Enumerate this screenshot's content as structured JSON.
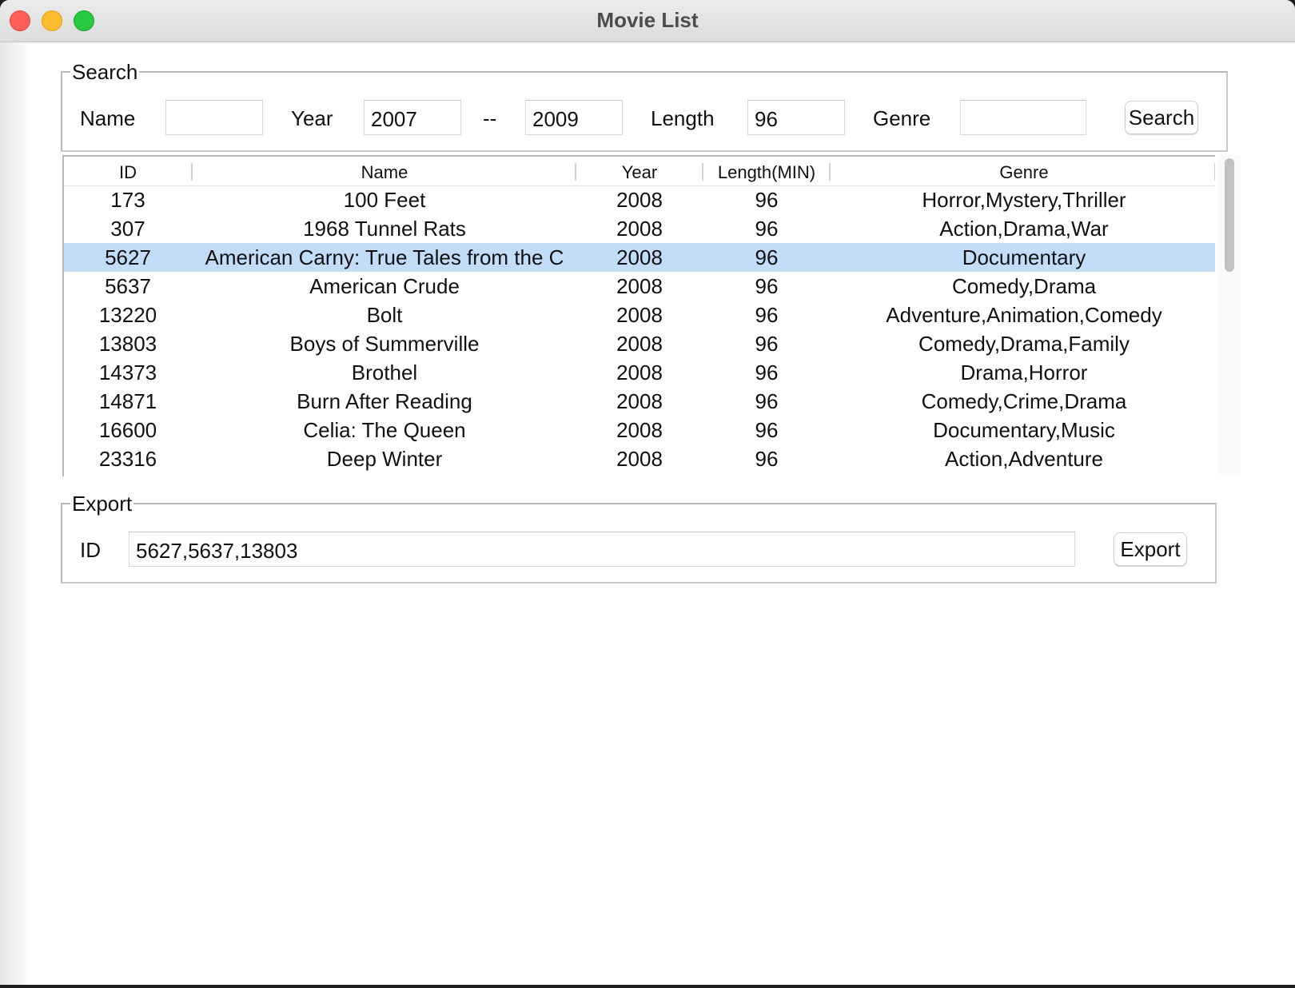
{
  "window": {
    "title": "Movie List"
  },
  "search": {
    "legend": "Search",
    "name_label": "Name",
    "name_value": "",
    "year_label": "Year",
    "year_from": "2007",
    "year_sep": "--",
    "year_to": "2009",
    "length_label": "Length",
    "length_value": "96",
    "genre_label": "Genre",
    "genre_value": "",
    "button": "Search"
  },
  "table": {
    "columns": [
      "ID",
      "Name",
      "Year",
      "Length(MIN)",
      "Genre"
    ],
    "selected_row": 2,
    "rows": [
      [
        "173",
        "100 Feet",
        "2008",
        "96",
        "Horror,Mystery,Thriller"
      ],
      [
        "307",
        "1968 Tunnel Rats",
        "2008",
        "96",
        "Action,Drama,War"
      ],
      [
        "5627",
        "American Carny: True Tales from the C",
        "2008",
        "96",
        "Documentary"
      ],
      [
        "5637",
        "American Crude",
        "2008",
        "96",
        "Comedy,Drama"
      ],
      [
        "13220",
        "Bolt",
        "2008",
        "96",
        "Adventure,Animation,Comedy"
      ],
      [
        "13803",
        "Boys of Summerville",
        "2008",
        "96",
        "Comedy,Drama,Family"
      ],
      [
        "14373",
        "Brothel",
        "2008",
        "96",
        "Drama,Horror"
      ],
      [
        "14871",
        "Burn After Reading",
        "2008",
        "96",
        "Comedy,Crime,Drama"
      ],
      [
        "16600",
        "Celia: The Queen",
        "2008",
        "96",
        "Documentary,Music"
      ],
      [
        "23316",
        "Deep Winter",
        "2008",
        "96",
        "Action,Adventure"
      ],
      [
        "",
        "",
        "",
        "",
        ""
      ]
    ]
  },
  "export": {
    "legend": "Export",
    "id_label": "ID",
    "id_value": "5627,5637,13803",
    "button": "Export"
  },
  "colors": {
    "selection": "#c3ddf8"
  }
}
